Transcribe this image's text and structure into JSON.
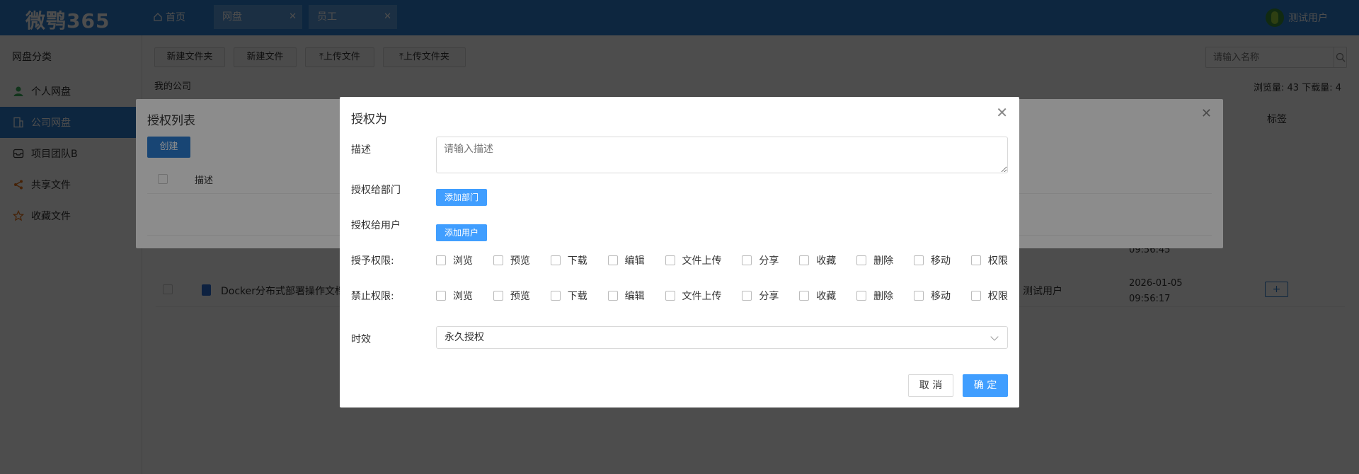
{
  "header": {
    "logo": "微鹗365",
    "home": "首页",
    "tabs": [
      {
        "label": "网盘"
      },
      {
        "label": "员工"
      }
    ],
    "user": "测试用户"
  },
  "sidebar": {
    "title": "网盘分类",
    "items": [
      {
        "label": "个人网盘",
        "icon": "person-icon"
      },
      {
        "label": "公司网盘",
        "icon": "building-icon"
      },
      {
        "label": "项目团队B",
        "icon": "inbox-icon"
      },
      {
        "label": "共享文件",
        "icon": "share-icon"
      },
      {
        "label": "收藏文件",
        "icon": "star-icon"
      }
    ]
  },
  "toolbar": {
    "new_folder": "新建文件夹",
    "new_file": "新建文件",
    "upload_file": "⤒上传文件",
    "upload_folder": "⤒上传文件夹"
  },
  "search": {
    "placeholder": "请输入名称"
  },
  "breadcrumb": "我的公司",
  "stats": "浏览量: 43  下载量: 4",
  "table": {
    "tag_header": "标签",
    "row1_time": "09:56:45",
    "row2": {
      "name": "Docker分布式部署操作文档",
      "owner": "测试用户",
      "date_line1": "2026-01-05",
      "date_line2": "09:56:17",
      "add": "+"
    }
  },
  "auth_list_dialog": {
    "title": "授权列表",
    "create": "创建",
    "col_desc": "描述"
  },
  "auth_dialog": {
    "title": "授权为",
    "desc_label": "描述",
    "desc_placeholder": "请输入描述",
    "dept_label": "授权给部门",
    "dept_button": "添加部门",
    "user_label": "授权给用户",
    "user_button": "添加用户",
    "grant_label": "授予权限:",
    "deny_label": "禁止权限:",
    "permissions": [
      "浏览",
      "预览",
      "下载",
      "编辑",
      "文件上传",
      "分享",
      "收藏",
      "删除",
      "移动",
      "权限"
    ],
    "validity_label": "时效",
    "validity_value": "永久授权",
    "cancel": "取 消",
    "ok": "确 定"
  }
}
